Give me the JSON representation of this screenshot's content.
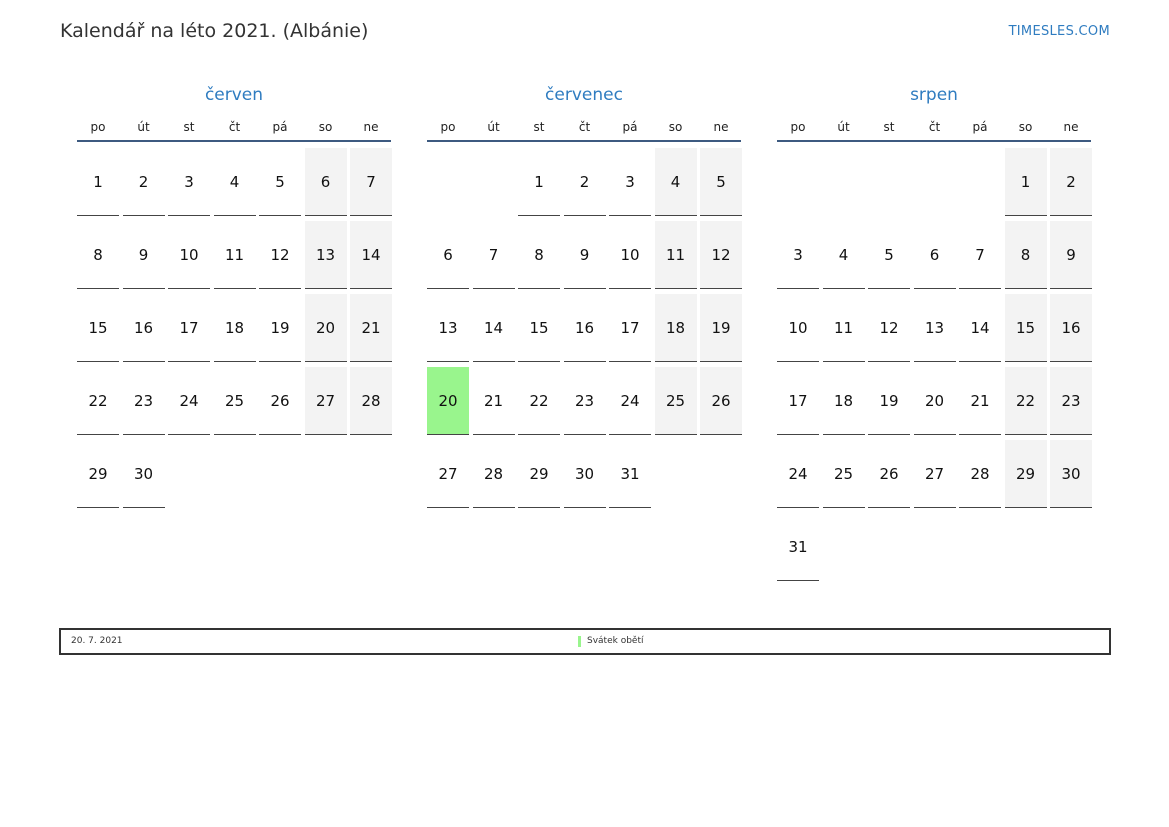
{
  "header": {
    "title": "Kalendář na léto 2021. (Albánie)",
    "brand": "TIMESLES.COM"
  },
  "colors": {
    "accent": "#2f7cc0",
    "weekend": "#f3f3f3",
    "holiday": "#99f58d"
  },
  "weekdays": [
    "po",
    "út",
    "st",
    "čt",
    "pá",
    "so",
    "ne"
  ],
  "months": [
    {
      "name": "červen",
      "first_weekday": 1,
      "days": 30,
      "holidays": []
    },
    {
      "name": "červenec",
      "first_weekday": 3,
      "days": 31,
      "holidays": [
        20
      ]
    },
    {
      "name": "srpen",
      "first_weekday": 6,
      "days": 31,
      "holidays": []
    }
  ],
  "legend": {
    "date": "20. 7. 2021",
    "name": "Svátek obětí"
  }
}
